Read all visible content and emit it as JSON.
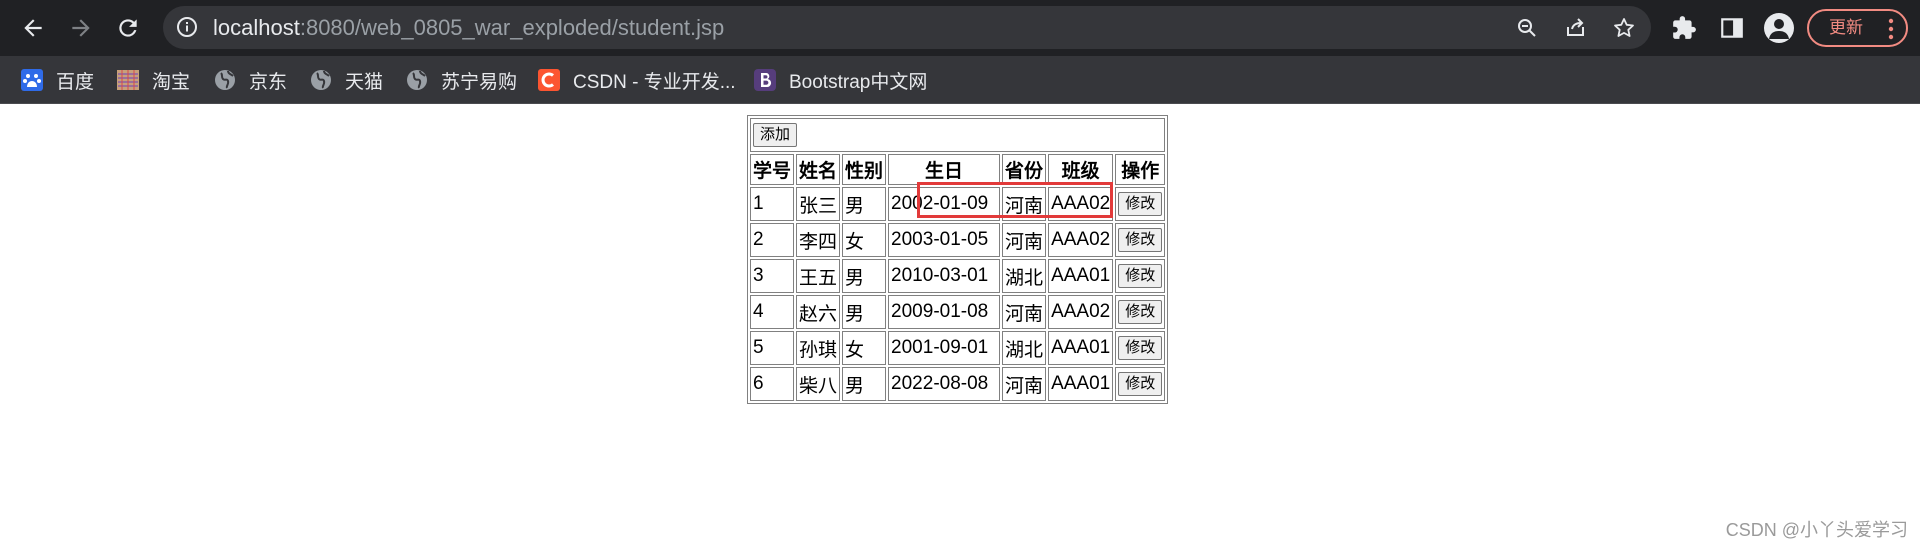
{
  "browser": {
    "url_host": "localhost",
    "url_rest": ":8080/web_0805_war_exploded/student.jsp",
    "update_label": "更新",
    "bookmarks": [
      {
        "icon": "baidu-icon",
        "label": "百度"
      },
      {
        "icon": "taobao-icon",
        "label": "淘宝"
      },
      {
        "icon": "globe-icon",
        "label": "京东"
      },
      {
        "icon": "globe-icon",
        "label": "天猫"
      },
      {
        "icon": "globe-icon",
        "label": "苏宁易购"
      },
      {
        "icon": "csdn-icon",
        "label": "CSDN - 专业开发..."
      },
      {
        "icon": "bootstrap-icon",
        "label": "Bootstrap中文网"
      }
    ],
    "colors": {
      "chrome_bg": "#202124",
      "omnibox_bg": "#35363a",
      "update_accent": "#f28b82"
    }
  },
  "page": {
    "add_button_label": "添加",
    "table": {
      "headers": [
        "学号",
        "姓名",
        "性别",
        "生日",
        "省份",
        "班级",
        "操作"
      ],
      "rows": [
        {
          "id": "1",
          "name": "张三",
          "gender": "男",
          "birthday": "2002-01-09",
          "province": "河南",
          "class": "AAA02",
          "action": "修改"
        },
        {
          "id": "2",
          "name": "李四",
          "gender": "女",
          "birthday": "2003-01-05",
          "province": "河南",
          "class": "AAA02",
          "action": "修改"
        },
        {
          "id": "3",
          "name": "王五",
          "gender": "男",
          "birthday": "2010-03-01",
          "province": "湖北",
          "class": "AAA01",
          "action": "修改"
        },
        {
          "id": "4",
          "name": "赵六",
          "gender": "男",
          "birthday": "2009-01-08",
          "province": "河南",
          "class": "AAA02",
          "action": "修改"
        },
        {
          "id": "5",
          "name": "孙琪",
          "gender": "女",
          "birthday": "2001-09-01",
          "province": "湖北",
          "class": "AAA01",
          "action": "修改"
        },
        {
          "id": "6",
          "name": "柴八",
          "gender": "男",
          "birthday": "2022-08-08",
          "province": "河南",
          "class": "AAA01",
          "action": "修改"
        }
      ]
    },
    "highlight_color": "#e23a3a"
  },
  "watermark": "CSDN @小丫头爱学习"
}
